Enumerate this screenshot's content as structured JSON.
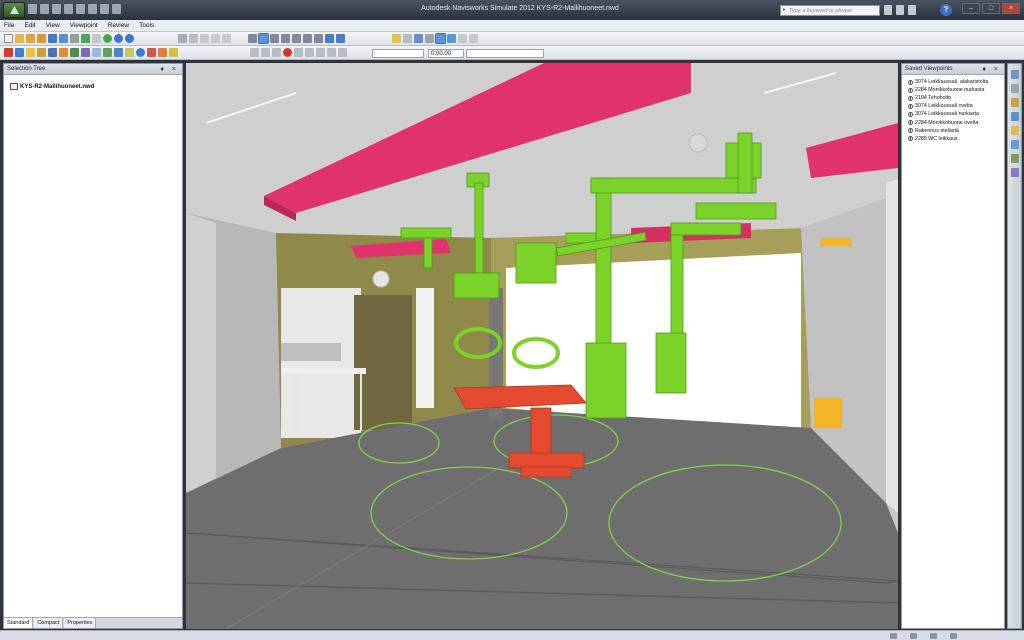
{
  "window": {
    "title": "Autodesk Navisworks Simulate 2012    KYS-R2-Mallihuoneet.nwd",
    "search_placeholder": "Type a keyword or phrase",
    "minimize": "–",
    "maximize": "□",
    "close": "×"
  },
  "menu": [
    "File",
    "Edit",
    "View",
    "Viewpoint",
    "Review",
    "Tools"
  ],
  "toolbar": {
    "time_value": "0:00.00"
  },
  "selection_tree": {
    "title": "Selection Tree",
    "controls": "♦ ×",
    "root_item": "KYS-R2-Mallihuoneet.nwd",
    "tabs": [
      "Standard",
      "Compact",
      "Properties"
    ]
  },
  "saved_viewpoints": {
    "title": "Saved Viewpoints",
    "controls": "♦ ×",
    "items": [
      "3074 Leikkaussali, alakaristolta",
      "2284 Monikkohuone nurkasta",
      "2104 Tehohoito",
      "3074 Leikkaussali ovelta",
      "3074 Leikkaussali nurkasta",
      "2284 Monikkohuone ovelta",
      "Rakennus etelästä",
      "2285 WC leikkaus"
    ]
  },
  "colors": {
    "ceiling_panel": "#e1336b",
    "equipment": "#7bd329",
    "table": "#e34a30",
    "floor": "#6e6e6e",
    "wall_olive": "#8f8a4a"
  }
}
